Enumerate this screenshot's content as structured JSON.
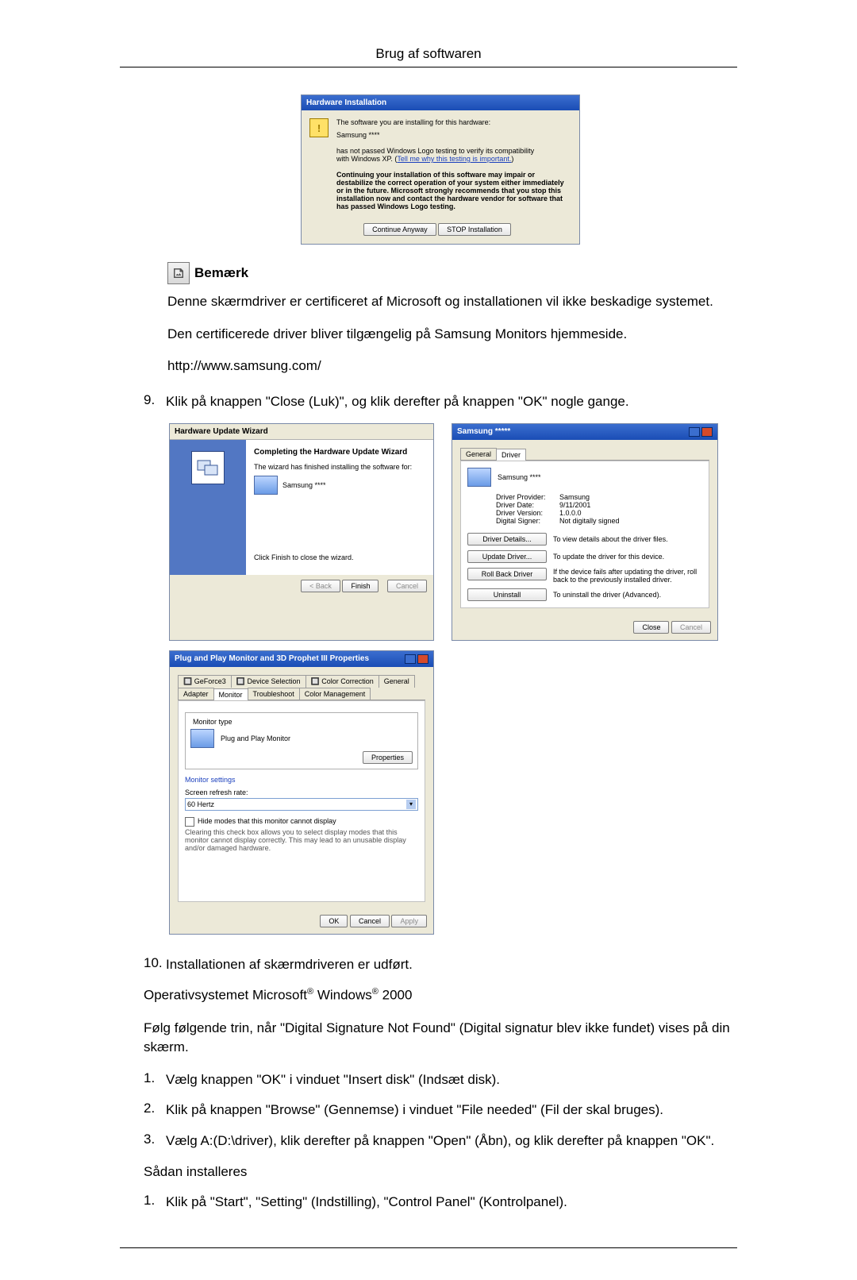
{
  "page_header": "Brug af softwaren",
  "hw_install": {
    "title": "Hardware Installation",
    "line1": "The software you are installing for this hardware:",
    "device": "Samsung ****",
    "line2a": "has not passed Windows Logo testing to verify its compatibility",
    "line2b": "with Windows XP. (",
    "tell_me": "Tell me why this testing is important.",
    "line2c": ")",
    "warn": "Continuing your installation of this software may impair or destabilize the correct operation of your system either immediately or in the future. Microsoft strongly recommends that you stop this installation now and contact the hardware vendor for software that has passed Windows Logo testing.",
    "btn_continue": "Continue Anyway",
    "btn_stop": "STOP Installation"
  },
  "note": {
    "heading": "Bemærk",
    "p1": "Denne skærmdriver er certificeret af Microsoft og installationen vil ikke beskadige systemet.",
    "p2": "Den certificerede driver bliver tilgængelig på Samsung Monitors hjemmeside.",
    "p3": "http://www.samsung.com/"
  },
  "step9": {
    "num": "9.",
    "text": "Klik på knappen \"Close (Luk)\", og klik derefter på knappen \"OK\" nogle gange."
  },
  "wizard": {
    "title": "Hardware Update Wizard",
    "heading": "Completing the Hardware Update Wizard",
    "line1": "The wizard has finished installing the software for:",
    "device": "Samsung ****",
    "close_hint": "Click Finish to close the wizard.",
    "back": "< Back",
    "finish": "Finish",
    "cancel": "Cancel"
  },
  "driver_dlg": {
    "title": "Samsung *****",
    "tab_general": "General",
    "tab_driver": "Driver",
    "device": "Samsung ****",
    "provider_l": "Driver Provider:",
    "provider_v": "Samsung",
    "date_l": "Driver Date:",
    "date_v": "9/11/2001",
    "version_l": "Driver Version:",
    "version_v": "1.0.0.0",
    "signer_l": "Digital Signer:",
    "signer_v": "Not digitally signed",
    "btn_details": "Driver Details...",
    "btn_details_t": "To view details about the driver files.",
    "btn_update": "Update Driver...",
    "btn_update_t": "To update the driver for this device.",
    "btn_rollback": "Roll Back Driver",
    "btn_rollback_t": "If the device fails after updating the driver, roll back to the previously installed driver.",
    "btn_uninstall": "Uninstall",
    "btn_uninstall_t": "To uninstall the driver (Advanced).",
    "close": "Close",
    "cancel": "Cancel"
  },
  "props": {
    "title": "Plug and Play Monitor and 3D Prophet III Properties",
    "tab_geforce": "GeForce3",
    "tab_devsel": "Device Selection",
    "tab_colorcorr": "Color Correction",
    "tab_general": "General",
    "tab_adapter": "Adapter",
    "tab_monitor": "Monitor",
    "tab_trouble": "Troubleshoot",
    "tab_colormgmt": "Color Management",
    "mtype_h": "Monitor type",
    "mtype": "Plug and Play Monitor",
    "btn_props": "Properties",
    "mset_h": "Monitor settings",
    "refresh_l": "Screen refresh rate:",
    "refresh_v": "60 Hertz",
    "hide_chk": "Hide modes that this monitor cannot display",
    "hide_t": "Clearing this check box allows you to select display modes that this monitor cannot display correctly. This may lead to an unusable display and/or damaged hardware.",
    "ok": "OK",
    "cancel": "Cancel",
    "apply": "Apply"
  },
  "step10": {
    "num": "10.",
    "text": "Installationen af skærmdriveren er udført."
  },
  "os_line_a": "Operativsystemet Microsoft",
  "os_line_b": " Windows",
  "os_line_c": " 2000",
  "dig_sig": "Følg følgende trin, når \"Digital Signature Not Found\" (Digital signatur blev ikke fundet) vises på din skærm.",
  "s1": {
    "num": "1.",
    "text": "Vælg knappen \"OK\" i vinduet \"Insert disk\" (Indsæt disk)."
  },
  "s2": {
    "num": "2.",
    "text": "Klik på knappen \"Browse\" (Gennemse) i vinduet \"File needed\" (Fil der skal bruges)."
  },
  "s3": {
    "num": "3.",
    "text": "Vælg A:(D:\\driver), klik derefter på knappen \"Open\" (Åbn), og klik derefter på knappen \"OK\"."
  },
  "install_h": "Sådan installeres",
  "i1": {
    "num": "1.",
    "text": "Klik på \"Start\", \"Setting\" (Indstilling), \"Control Panel\" (Kontrolpanel)."
  }
}
